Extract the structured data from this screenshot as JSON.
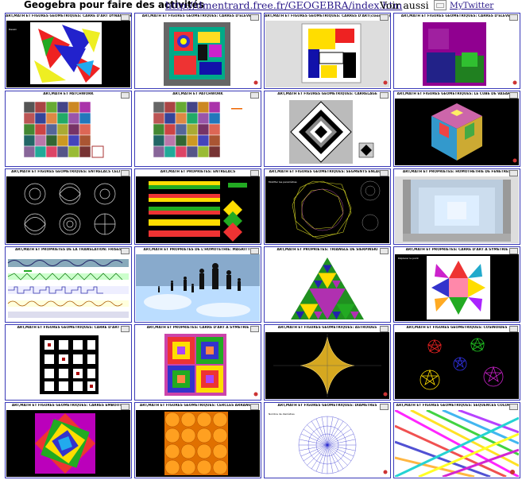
{
  "header": {
    "title": "Geogebra pour faire des activités",
    "link": "http://dmentrard.free.fr/GEOGEBRA/index.htm",
    "voir_aussi": "Voir aussi",
    "twitter_label": "MyTwitter",
    "twitter_icon": "image-placeholder-icon"
  },
  "tiles": [
    {
      "title": "ART,MATH ET FIGURES GEOMETRIQUES: CARRE D'ART DYNAMIQUE"
    },
    {
      "title": "ART,MATH ET FIGURES GEOMETRIQUES: CARRES D'ELEVES"
    },
    {
      "title": "ART,MATH ET FIGURES GEOMETRIQUES: CARRES D'ART(classique)"
    },
    {
      "title": "ART,MATH ET FIGURES GEOMETRIQUES: CARRES D'ELEVES"
    },
    {
      "title": "ART,MATH ET PATCHWORK"
    },
    {
      "title": "ART,MATH ET PATCHWORK"
    },
    {
      "title": "ART,MATH ET FIGURES GEOMETRIQUES: CARRELAGE"
    },
    {
      "title": "ART,MATH ET FIGURES GEOMETRIQUES: LE CUBE DE VASARELY"
    },
    {
      "title": "ART,MATH ET FIGURES GEOMETRIQUES: ENTRELACS CELTES"
    },
    {
      "title": "ART,MATH ET PROPRIETES: ENTRELACS"
    },
    {
      "title": "ART,MATH ET FIGURES GEOMETRIQUES: SEGMENTS ENLACES"
    },
    {
      "title": "ART,MATH ET PROPRIETES: HOMOTHETHIE DE FENETRES"
    },
    {
      "title": "ART,MATH ET PROPRIETES DE LA TRANSLATION: FRISES"
    },
    {
      "title": "ART,MATH ET PROPRIETES DE L'HOMOTETHIE: MAGRITTE"
    },
    {
      "title": "ART,MATH ET PROPRIETES: TRIANGLE DE SIERPINSKI"
    },
    {
      "title": "ART,MATH ET PROPRIETES: CARRE D'ART A SYMETRIE"
    },
    {
      "title": "ART,MATH ET FIGURES GEOMETRIQUES: CARRE D'ART"
    },
    {
      "title": "ART,MATH ET PROPRIETES: CARRE D'ART A SYMETRIE"
    },
    {
      "title": "ART,MATH ET FIGURES GEOMETRIQUES: ASTROIDES"
    },
    {
      "title": "ART,MATH ET FIGURES GEOMETRIQUES: COSINOIDES"
    },
    {
      "title": "ART,MATH ET FIGURES GEOMETRIQUES: CARRES EMBOITES"
    },
    {
      "title": "ART,MATH ET FIGURES GEOMETRIQUES: CERCLES ARRANGES"
    },
    {
      "title": "ART,MATH ET FIGURES GEOMETRIQUES: DIAMETRES"
    },
    {
      "title": "ART,MATH ET FIGURES GEOMETRIQUES: SEQUENCES COLOREES"
    }
  ]
}
